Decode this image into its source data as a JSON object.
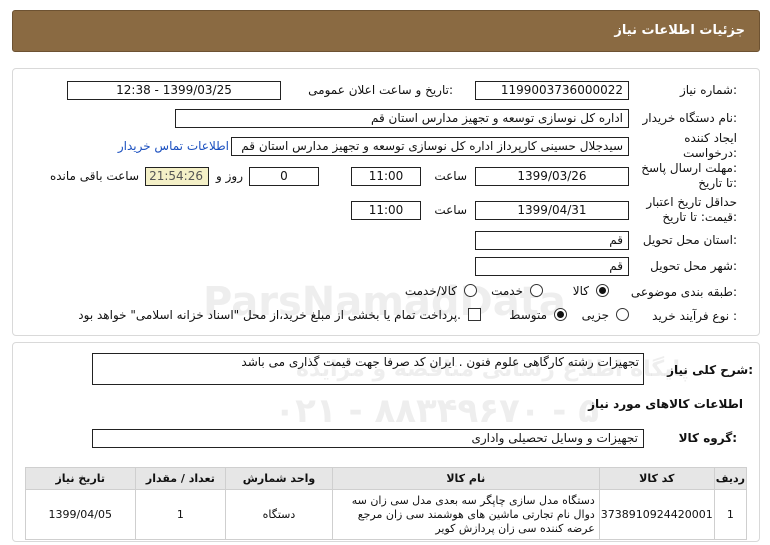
{
  "page": {
    "title": "جزئیات اطلاعات نیاز"
  },
  "info": {
    "need_number_label": "شماره نیاز:",
    "need_number": "1199003736000022",
    "announce_label": "تاریخ و ساعت اعلان عمومی:",
    "announce_value": "1399/03/25 - 12:38",
    "buyer_label": "نام دستگاه خریدار:",
    "buyer_value": "اداره کل نوسازی توسعه و تجهیز مدارس استان قم",
    "creator_label_1": "ایجاد کننده",
    "creator_label_2": "درخواست:",
    "creator_value": "سیدجلال حسینی کارپرداز اداره کل نوسازی توسعه و تجهیز مدارس استان قم",
    "contact_link": "اطلاعات تماس خریدار",
    "deadline_label_1": "مهلت ارسال پاسخ:",
    "deadline_label_2": "تا تاریخ:",
    "deadline_date": "1399/03/26",
    "time_label": "ساعت",
    "deadline_time": "11:00",
    "days_value": "0",
    "days_label": "روز و",
    "remaining_time": "21:54:26",
    "remaining_label": "ساعت باقی مانده",
    "validity_label_1": "حداقل تاریخ اعتبار",
    "validity_label_2": "قیمت: تا تاریخ:",
    "validity_date": "1399/04/31",
    "validity_time": "11:00",
    "province_label": "استان محل تحویل:",
    "province_value": "قم",
    "city_label": "شهر محل تحویل:",
    "city_value": "قم",
    "category_label": "طبقه بندی موضوعی:",
    "category_options": [
      "کالا",
      "خدمت",
      "کالا/خدمت"
    ],
    "process_label": "نوع فرآیند خرید :",
    "process_options": [
      "جزیی",
      "متوسط"
    ],
    "payment_note": "پرداخت تمام یا بخشی از مبلغ خرید،از محل \"اسناد خزانه اسلامی\" خواهد بود."
  },
  "description": {
    "label": "شرح کلی نیاز:",
    "value": "تجهیزات رشته کارگاهی علوم فنون . ایران کد صرفا جهت قیمت گذاری می باشد"
  },
  "goods": {
    "section_title": "اطلاعات کالاهای مورد نیاز",
    "group_label": "گروه کالا:",
    "group_value": "تجهیزات و وسایل تحصیلی واداری",
    "columns": [
      "ردیف",
      "کد کالا",
      "نام کالا",
      "واحد شمارش",
      "تعداد / مقدار",
      "تاریخ نیاز"
    ],
    "rows": [
      {
        "row": "1",
        "code": "3738910924420001",
        "name": "دستگاه مدل سازی چاپگر سه بعدی مدل سی زان سه دوال نام تجارتی ماشین های هوشمند سی زان مرجع عرضه کننده سی زان پردازش کویر",
        "unit": "دستگاه",
        "qty": "1",
        "date": "1399/04/05"
      }
    ]
  },
  "watermark": {
    "brand": "ParsNamadData",
    "line1": "پایگاه اطلاع رسانی مناقصه و مزایده",
    "phone": "۰۲۱ - ۸۸۳۴۹۶۷۰ - ۵"
  }
}
